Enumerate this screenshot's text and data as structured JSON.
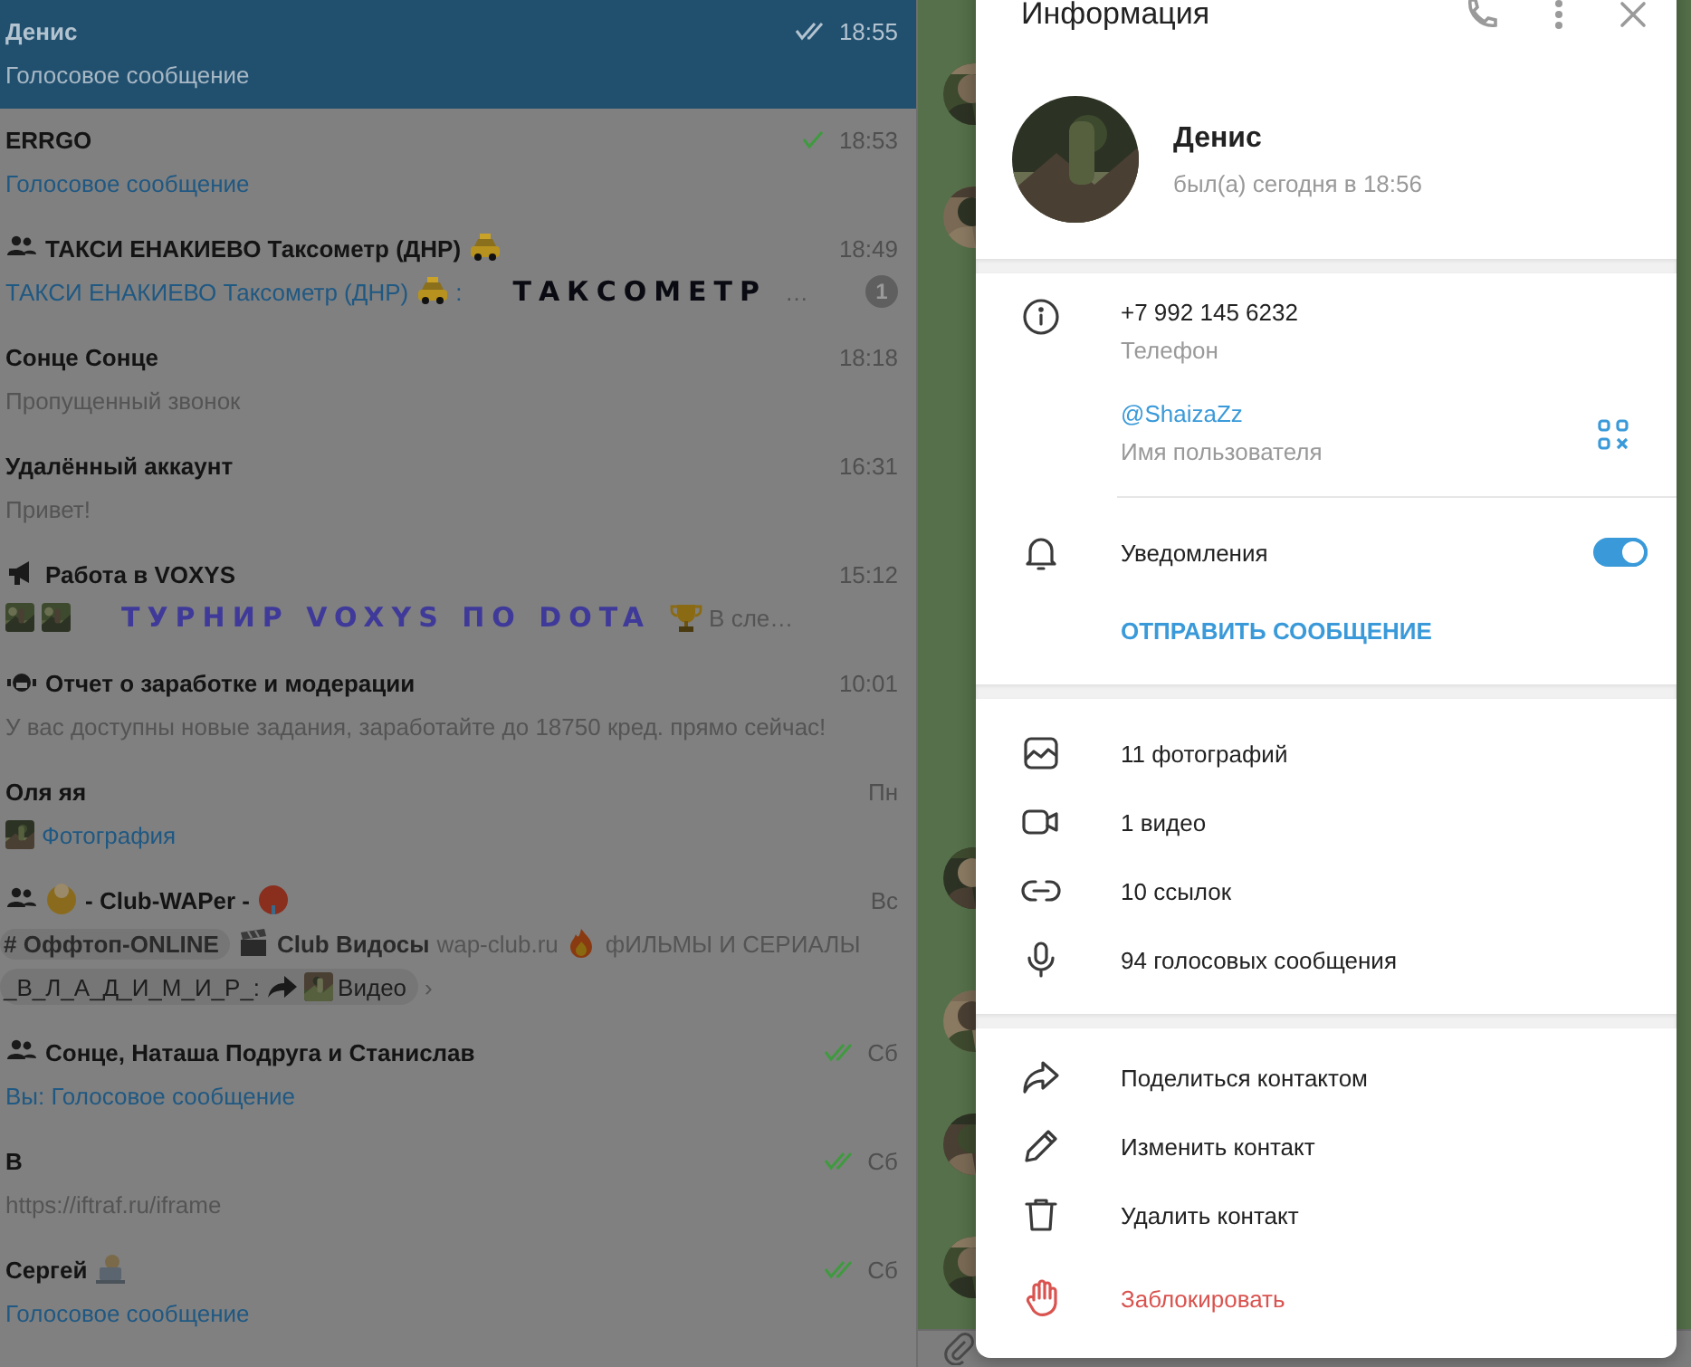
{
  "chat_list": [
    {
      "title": [
        {
          "kind": "text",
          "text": "Денис"
        }
      ],
      "time": "18:55",
      "status": {
        "kind": "read"
      },
      "selected": true,
      "preview": [
        [
          {
            "kind": "text",
            "text": "Голосовое сообщение"
          }
        ]
      ]
    },
    {
      "title": [
        {
          "kind": "text",
          "text": "ERRGO"
        }
      ],
      "time": "18:53",
      "status": {
        "kind": "sent"
      },
      "selected": false,
      "preview": [
        [
          {
            "kind": "accent",
            "text": "Голосовое сообщение"
          }
        ]
      ]
    },
    {
      "title": [
        {
          "kind": "group"
        },
        {
          "kind": "text",
          "text": "ТАКСИ ЕНАКИЕВО Таксометр (ДНР)"
        },
        {
          "kind": "taxi"
        }
      ],
      "time": "18:49",
      "unread": "1",
      "selected": false,
      "preview": [
        [
          {
            "kind": "accent",
            "text": "ТАКСИ ЕНАКИЕВО Таксометр (ДНР)"
          },
          {
            "kind": "taxi"
          },
          {
            "kind": "accent",
            "text": ":"
          },
          {
            "kind": "fancy",
            "text": "ТАКСОМЕТР",
            "color": "#0a0a12"
          },
          {
            "kind": "text",
            "text": "…"
          }
        ]
      ]
    },
    {
      "title": [
        {
          "kind": "text",
          "text": "Сонце Сонце"
        }
      ],
      "time": "18:18",
      "selected": false,
      "preview": [
        [
          {
            "kind": "text",
            "text": "Пропущенный звонок"
          }
        ]
      ]
    },
    {
      "title": [
        {
          "kind": "text",
          "text": "Удалённый аккаунт"
        }
      ],
      "time": "16:31",
      "selected": false,
      "preview": [
        [
          {
            "kind": "text",
            "text": "Привет!"
          }
        ]
      ]
    },
    {
      "title": [
        {
          "kind": "channel"
        },
        {
          "kind": "text",
          "text": "Работа в VOXYS"
        }
      ],
      "time": "15:12",
      "selected": false,
      "preview": [
        [
          {
            "kind": "thumb"
          },
          {
            "kind": "thumb"
          },
          {
            "kind": "fancy",
            "text": "ТУРНИР VOXYS ПО DOTA",
            "color": "#3f3a9a"
          },
          {
            "kind": "trophy"
          },
          {
            "kind": "text",
            "text": "В сле…"
          }
        ]
      ]
    },
    {
      "title": [
        {
          "kind": "bot"
        },
        {
          "kind": "text",
          "text": "Отчет о заработке и модерации"
        }
      ],
      "time": "10:01",
      "selected": false,
      "preview": [
        [
          {
            "kind": "text",
            "text": "У вас доступны новые задания, заработайте до 18750 кред. прямо сейчас!"
          }
        ]
      ]
    },
    {
      "title": [
        {
          "kind": "text",
          "text": "Оля яя"
        }
      ],
      "time": "Пн",
      "selected": false,
      "preview": [
        [
          {
            "kind": "thumb"
          },
          {
            "kind": "accent",
            "text": "Фотография"
          }
        ]
      ]
    },
    {
      "title": [
        {
          "kind": "group"
        },
        {
          "kind": "round"
        },
        {
          "kind": "text",
          "text": "- Club-WAPer -"
        },
        {
          "kind": "roundred"
        }
      ],
      "time": "Вс",
      "selected": false,
      "preview": [
        [
          {
            "kind": "strong",
            "text": "# Оффтоп-ONLINE",
            "chip": true
          },
          {
            "kind": "clapper"
          },
          {
            "kind": "strong",
            "text": "Club Видосы"
          },
          {
            "kind": "text",
            "text": "wap-club.ru"
          },
          {
            "kind": "fire"
          },
          {
            "kind": "text",
            "text": "фИЛЬМЫ И СЕРИАЛЫ"
          }
        ],
        [
          {
            "kind": "dark",
            "text": "_В_Л_А_Д_И_М_И_Р_:",
            "chip": true
          },
          {
            "kind": "forward",
            "chip": true
          },
          {
            "kind": "thumb",
            "chip": true
          },
          {
            "kind": "dark",
            "text": "Видео",
            "chip": true
          },
          {
            "kind": "text",
            "text": "›"
          }
        ]
      ]
    },
    {
      "title": [
        {
          "kind": "group"
        },
        {
          "kind": "text",
          "text": "Сонце, Наташа Подруга и Станислав"
        }
      ],
      "time": "Сб",
      "status": {
        "kind": "read"
      },
      "selected": false,
      "preview": [
        [
          {
            "kind": "accent",
            "text": "Вы: Голосовое сообщение"
          }
        ]
      ]
    },
    {
      "title": [
        {
          "kind": "text",
          "text": "В"
        }
      ],
      "time": "Сб",
      "status": {
        "kind": "read"
      },
      "selected": false,
      "preview": [
        [
          {
            "kind": "text",
            "text": "https://iftraf.ru/iframe"
          }
        ]
      ]
    },
    {
      "title": [
        {
          "kind": "text",
          "text": "Сергей"
        },
        {
          "kind": "laptop"
        }
      ],
      "time": "Сб",
      "status": {
        "kind": "read"
      },
      "selected": false,
      "preview": [
        [
          {
            "kind": "accent",
            "text": "Голосовое сообщение"
          }
        ]
      ]
    }
  ],
  "info_panel": {
    "title": "Информация",
    "profile": {
      "name": "Денис",
      "last_seen": "был(а) сегодня в 18:56"
    },
    "details": [
      {
        "kind": "phone",
        "value": "+7 992 145 6232",
        "label": "Телефон"
      },
      {
        "kind": "username",
        "value": "@ShaizaZz",
        "label": "Имя пользователя"
      }
    ],
    "notifications": {
      "label": "Уведомления",
      "on": true
    },
    "send_message": "ОТПРАВИТЬ СООБЩЕНИЕ",
    "media": [
      {
        "kind": "photos",
        "label": "11 фотографий"
      },
      {
        "kind": "videos",
        "label": "1 видео"
      },
      {
        "kind": "links",
        "label": "10 ссылок"
      },
      {
        "kind": "voice",
        "label": "94 голосовых сообщения"
      }
    ],
    "actions": [
      {
        "kind": "share",
        "label": "Поделиться контактом",
        "danger": false
      },
      {
        "kind": "edit",
        "label": "Изменить контакт",
        "danger": false
      },
      {
        "kind": "delete",
        "label": "Удалить контакт",
        "danger": false
      },
      {
        "kind": "block",
        "label": "Заблокировать",
        "danger": true
      }
    ]
  }
}
